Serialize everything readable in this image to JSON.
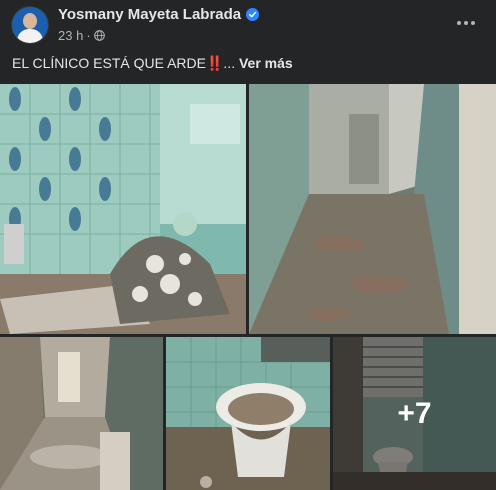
{
  "post": {
    "author": "Yosmany Mayeta Labrada",
    "time": "23 h",
    "separator": "·",
    "text_main": "EL CLÍNICO ESTÁ QUE ARDE",
    "text_emoji": "‼️",
    "ellipsis": "...",
    "see_more": "Ver más"
  },
  "icons": {
    "verified": "verified-badge-icon",
    "audience": "globe-icon",
    "more": "more-options-icon"
  },
  "colors": {
    "background": "#242526",
    "verified_blue": "#2d88ff",
    "text_primary": "#e4e6eb",
    "text_secondary": "#b0b3b8"
  },
  "photos": [
    {
      "label": "photo-1"
    },
    {
      "label": "photo-2"
    },
    {
      "label": "photo-3"
    },
    {
      "label": "photo-4"
    },
    {
      "label": "photo-5",
      "more_count": "+7"
    }
  ]
}
